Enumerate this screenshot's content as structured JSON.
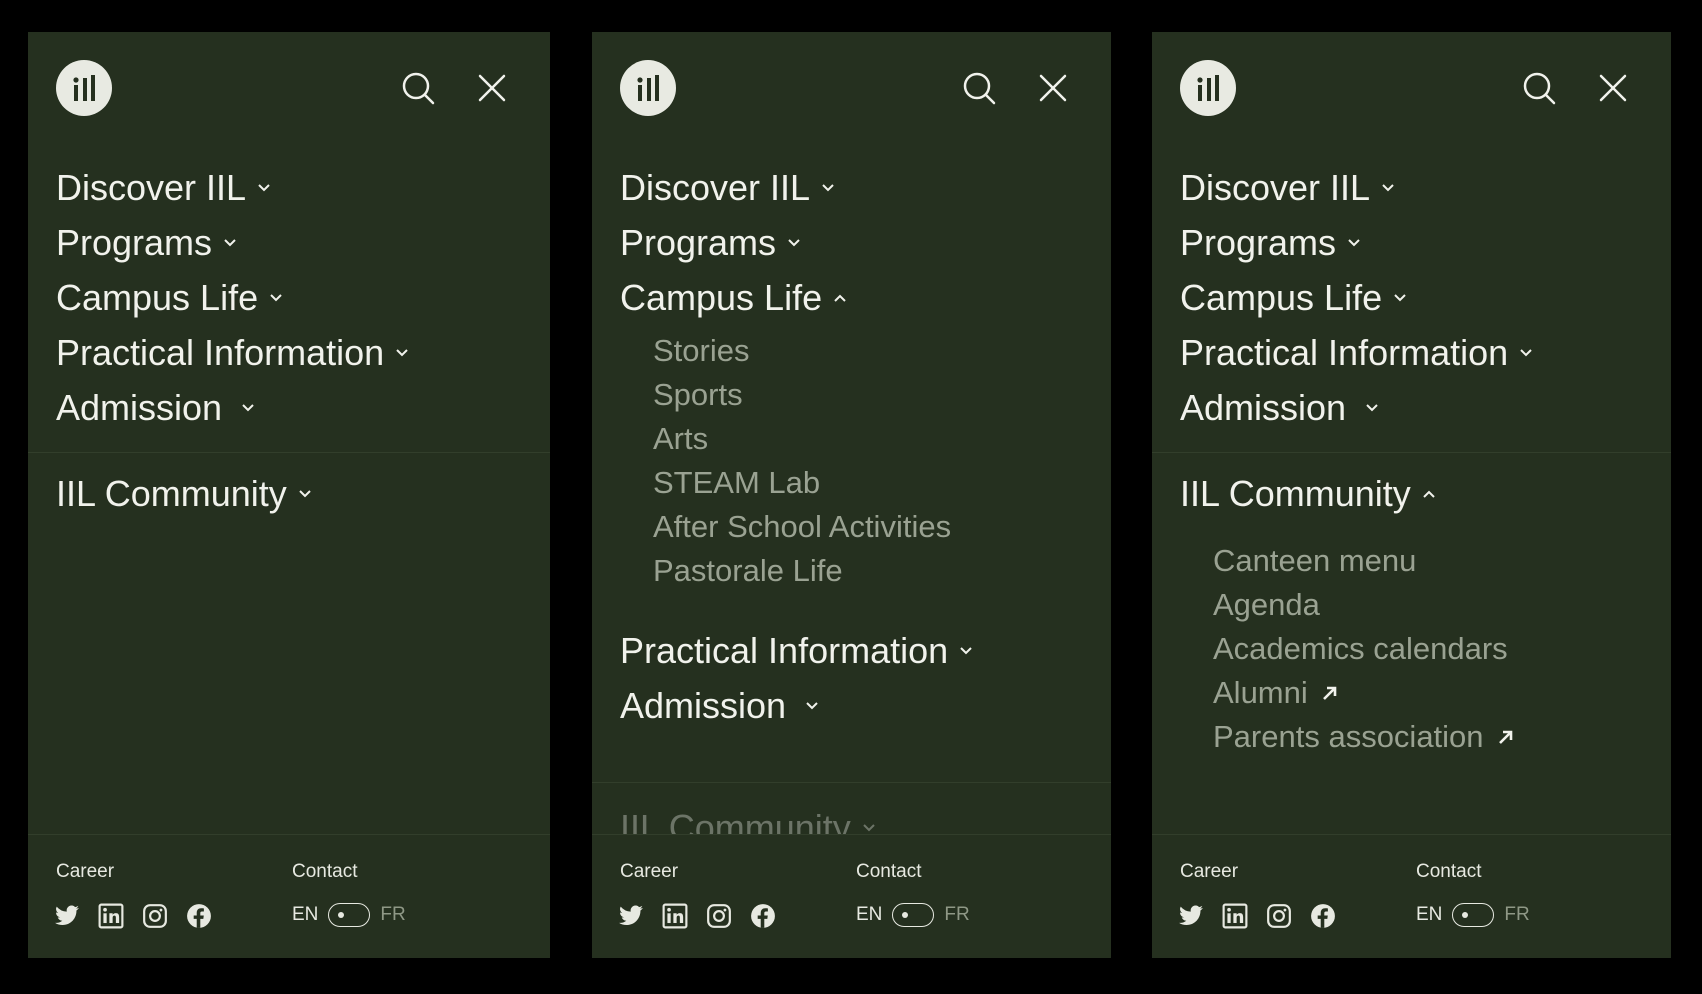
{
  "nav": {
    "discover": "Discover IIL",
    "programs": "Programs",
    "campus_life": "Campus Life",
    "practical": "Practical Information",
    "admission": "Admission",
    "community": "IIL Community"
  },
  "campus_life_sub": [
    "Stories",
    "Sports",
    "Arts",
    "STEAM Lab",
    "After School Activities",
    "Pastorale Life"
  ],
  "community_sub": [
    "Canteen menu",
    "Agenda",
    "Academics calendars",
    "Alumni",
    "Parents association"
  ],
  "footer": {
    "career": "Career",
    "contact": "Contact",
    "lang_en": "EN",
    "lang_fr": "FR"
  },
  "icons": {
    "logo": "iil-logo-icon",
    "search": "search-icon",
    "close": "close-icon",
    "social": [
      "twitter-icon",
      "linkedin-icon",
      "instagram-icon",
      "facebook-icon"
    ]
  },
  "colors": {
    "panel_bg": "#25301f",
    "text": "#f1f2ec",
    "submenu_text": "#9aa292",
    "page_bg": "#000000"
  }
}
